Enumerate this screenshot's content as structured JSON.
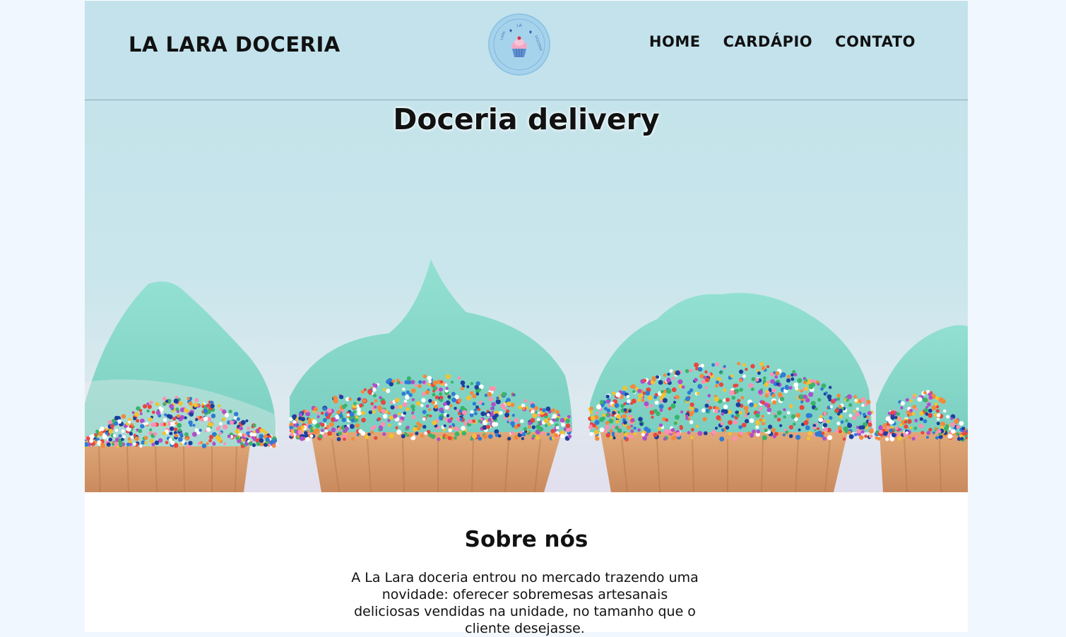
{
  "header": {
    "brand": "LA LARA DOCERIA",
    "logo_icon": "cupcake-logo-icon",
    "nav": [
      {
        "label": "HOME"
      },
      {
        "label": "CARDÁPIO"
      },
      {
        "label": "CONTATO"
      }
    ]
  },
  "hero": {
    "title": "Doceria delivery",
    "image": "cupcakes-with-sprinkles"
  },
  "about": {
    "title": "Sobre nós",
    "text": "A La Lara doceria entrou no mercado trazendo uma novidade: oferecer sobremesas artesanais deliciosas vendidas na unidade, no tamanho que o cliente desejasse."
  },
  "colors": {
    "header_bg": "#c3e2ec",
    "frosting": "#8fd9cc",
    "page_bg": "#f0f7ff"
  }
}
